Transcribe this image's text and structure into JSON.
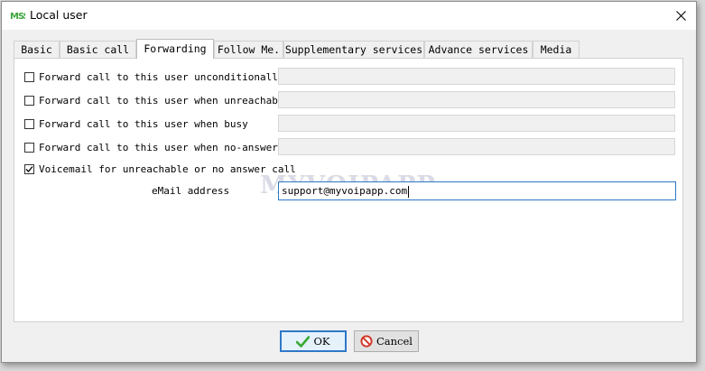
{
  "window": {
    "title": "Local user",
    "icon": "app-logo-icon",
    "accent": "#2f78c8"
  },
  "tabs": [
    {
      "label": "Basic",
      "active": false
    },
    {
      "label": "Basic call",
      "active": false
    },
    {
      "label": "Forwarding",
      "active": true
    },
    {
      "label": "Follow Me.",
      "active": false
    },
    {
      "label": "Supplementary services",
      "active": false
    },
    {
      "label": "Advance services",
      "active": false
    },
    {
      "label": "Media",
      "active": false
    }
  ],
  "forwarding": {
    "options": [
      {
        "label": "Forward call to this user unconditionally",
        "checked": false,
        "value": ""
      },
      {
        "label": "Forward call to this user when unreachable",
        "checked": false,
        "value": ""
      },
      {
        "label": "Forward call to this user when busy",
        "checked": false,
        "value": ""
      },
      {
        "label": "Forward call to this user when no-answer",
        "checked": false,
        "value": ""
      }
    ],
    "voicemail": {
      "label": "Voicemail for unreachable or no answer call",
      "checked": true
    },
    "email": {
      "label": "eMail address",
      "value": "support@myvoipapp.com"
    }
  },
  "watermark": "MYVOIPAPP",
  "buttons": {
    "ok": {
      "label": "OK",
      "icon": "checkmark-icon"
    },
    "cancel": {
      "label": "Cancel",
      "icon": "no-entry-icon"
    }
  }
}
